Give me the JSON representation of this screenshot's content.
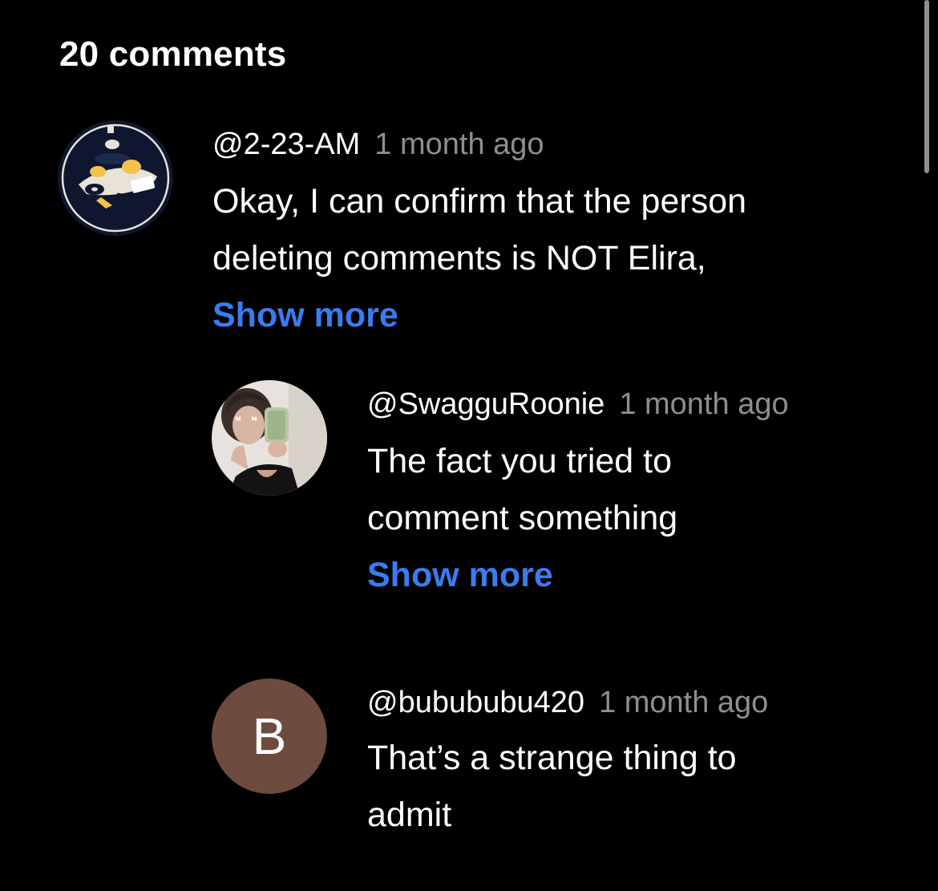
{
  "header": {
    "title": "20 comments"
  },
  "accent_color": "#3a7cf0",
  "comments": [
    {
      "author": "@2-23-AM",
      "time": "1 month ago",
      "lines": [
        "Okay, I can confirm that the person",
        "deleting comments is NOT Elira,"
      ],
      "show_more": "Show more",
      "avatar_icon": "desk-illustration-avatar"
    },
    {
      "author": "@SwagguRoonie",
      "time": "1 month ago",
      "lines": [
        "The fact you tried to",
        "comment something"
      ],
      "show_more": "Show more",
      "avatar_icon": "selfie-photo-avatar"
    },
    {
      "author": "@bubububu420",
      "time": "1 month ago",
      "lines": [
        "That’s a strange thing to",
        "admit"
      ],
      "avatar_letter": "B",
      "avatar_color": "#6e4b3f"
    }
  ]
}
